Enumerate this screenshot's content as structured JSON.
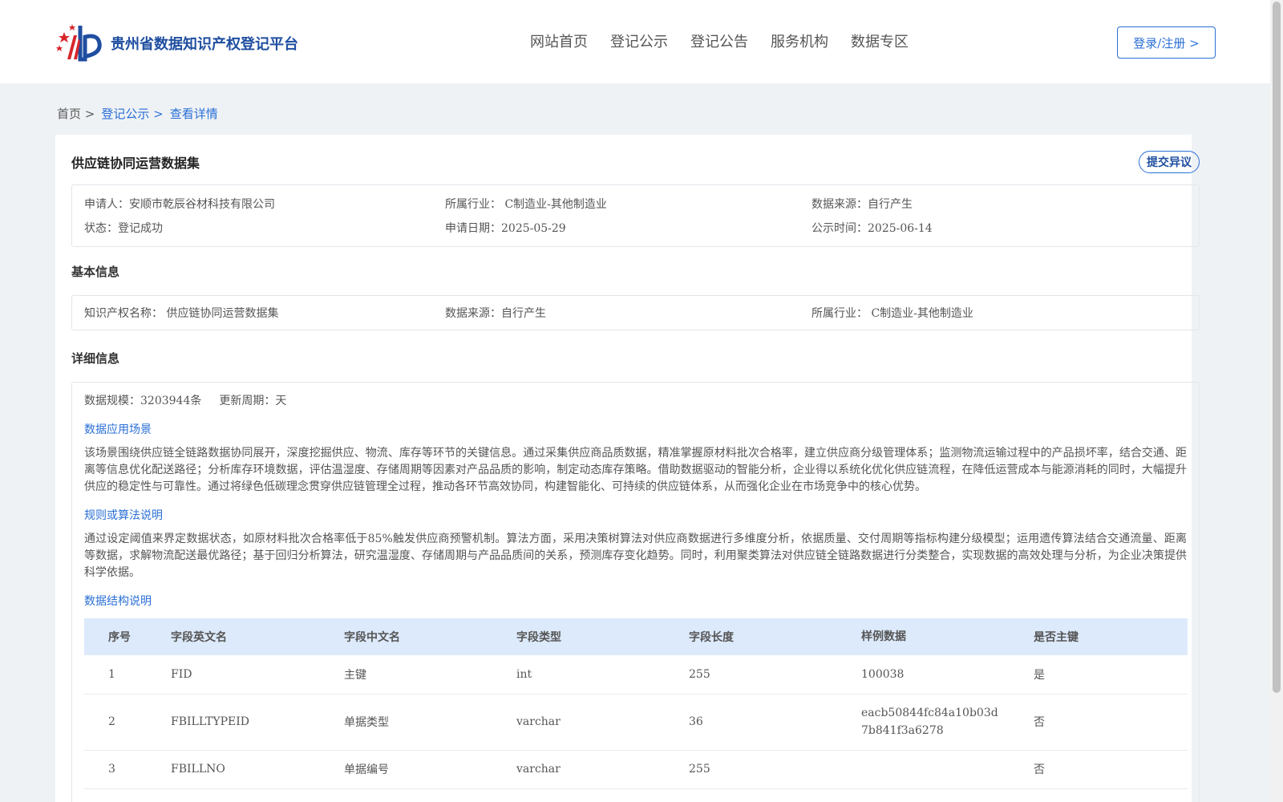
{
  "header": {
    "site_title": "贵州省数据知识产权登记平台",
    "nav": [
      "网站首页",
      "登记公示",
      "登记公告",
      "服务机构",
      "数据专区"
    ],
    "login_label": "登录/注册 >"
  },
  "breadcrumb": {
    "home": "首页 >",
    "section": "登记公示 >",
    "current": "查看详情"
  },
  "record": {
    "title": "供应链协同运营数据集",
    "objection_label": "提交异议",
    "summary": {
      "applicant": "申请人：安顺市乾辰谷材科技有限公司",
      "industry": "所属行业： C制造业-其他制造业",
      "source": "数据来源：自行产生",
      "status": "状态：登记成功",
      "apply_date": "申请日期：2025-05-29",
      "publish_date": "公示时间：2025-06-14"
    }
  },
  "basic": {
    "section_title": "基本信息",
    "ip_name": "知识产权名称： 供应链协同运营数据集",
    "source": "数据来源：自行产生",
    "industry": "所属行业： C制造业-其他制造业"
  },
  "detail": {
    "section_title": "详细信息",
    "scale": "数据规模：3203944条",
    "cycle": "更新周期：天",
    "scenario_title": "数据应用场景",
    "scenario_text": "该场景围绕供应链全链路数据协同展开，深度挖掘供应、物流、库存等环节的关键信息。通过采集供应商品质数据，精准掌握原材料批次合格率，建立供应商分级管理体系；监测物流运输过程中的产品损坏率，结合交通、距离等信息优化配送路径；分析库存环境数据，评估温湿度、存储周期等因素对产品品质的影响，制定动态库存策略。借助数据驱动的智能分析，企业得以系统化优化供应链流程，在降低运营成本与能源消耗的同时，大幅提升供应的稳定性与可靠性。通过将绿色低碳理念贯穿供应链管理全过程，推动各环节高效协同，构建智能化、可持续的供应链体系，从而强化企业在市场竞争中的核心优势。",
    "rule_title": "规则或算法说明",
    "rule_text": "通过设定阈值来界定数据状态，如原材料批次合格率低于85%触发供应商预警机制。算法方面，采用决策树算法对供应商数据进行多维度分析，依据质量、交付周期等指标构建分级模型；运用遗传算法结合交通流量、距离等数据，求解物流配送最优路径；基于回归分析算法，研究温湿度、存储周期与产品品质间的关系，预测库存变化趋势。同时，利用聚类算法对供应链全链路数据进行分类整合，实现数据的高效处理与分析，为企业决策提供科学依据。",
    "structure_title": "数据结构说明",
    "table": {
      "headers": [
        "序号",
        "字段英文名",
        "字段中文名",
        "字段类型",
        "字段长度",
        "样例数据",
        "是否主键"
      ],
      "rows": [
        [
          "1",
          "FID",
          "主键",
          "int",
          "255",
          "100038",
          "是"
        ],
        [
          "2",
          "FBILLTYPEID",
          "单据类型",
          "varchar",
          "36",
          "eacb50844fc84a10b03d7b841f3a6278",
          "否"
        ],
        [
          "3",
          "FBILLNO",
          "单据编号",
          "varchar",
          "255",
          "",
          "否"
        ]
      ]
    }
  }
}
